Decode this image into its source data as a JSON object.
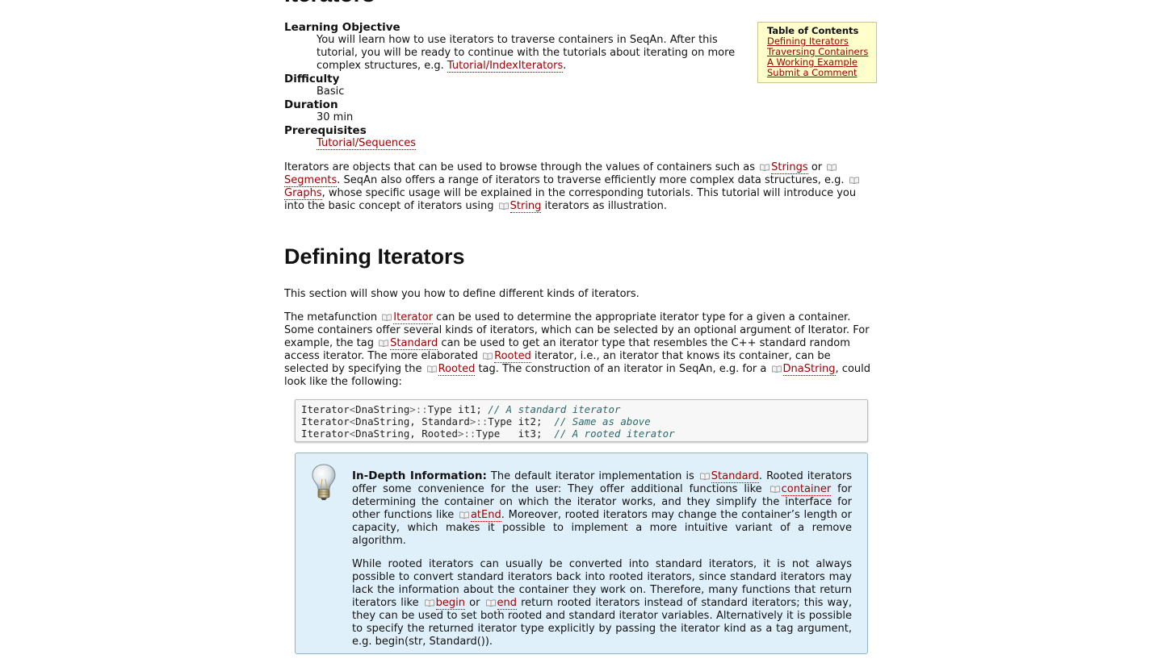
{
  "page_title": "Iterators",
  "meta": {
    "learning_objective_label": "Learning Objective",
    "learning_objective_text_before": "You will learn how to use iterators to traverse containers in SeqAn. After this tutorial, you will be ready to continue with the tutorials about iterating on more complex structures, e.g. ",
    "learning_objective_link": "Tutorial/IndexIterators",
    "learning_objective_text_after": ".",
    "difficulty_label": "Difficulty",
    "difficulty_value": "Basic",
    "duration_label": "Duration",
    "duration_value": "30 min",
    "prerequisites_label": "Prerequisites",
    "prerequisites_link": "Tutorial/Sequences"
  },
  "toc": {
    "title": "Table of Contents",
    "items": [
      "Defining Iterators",
      "Traversing Containers",
      "A Working Example",
      "Submit a Comment"
    ]
  },
  "intro": {
    "t1": "Iterators are objects that can be used to browse through the values of containers such as ",
    "l1": "Strings",
    "t2": " or ",
    "l2": "Segments",
    "t3": ". SeqAn also offers a range of iterators to traverse efficiently more complex data structures, e.g. ",
    "l3": "Graphs",
    "t4": ", whose specific usage will be explained in the corresponding tutorials. This tutorial will introduce you into the basic concept of iterators using ",
    "l4": "String",
    "t5": " iterators as illustration."
  },
  "section_heading": "Defining Iterators",
  "section_intro": "This section will show you how to define different kinds of iterators.",
  "metafunction": {
    "t1": "The metafunction ",
    "l1": "Iterator",
    "t2": " can be used to determine the appropriate iterator type for a given a container. Some containers offer several kinds of iterators, which can be selected by an optional argument of Iterator. For example, the tag ",
    "l2": "Standard",
    "t3": " can be used to get an iterator type that resembles the C++ standard random access iterator. The more elaborated ",
    "l3": "Rooted",
    "t4": " iterator, i.e., an iterator that knows its container, can be selected by specifying the ",
    "l4": "Rooted",
    "t5": " tag. The construction of an iterator in SeqAn, e.g. for a ",
    "l5": "DnaString",
    "t6": ", could look like the following:"
  },
  "code": {
    "line1": {
      "a": "Iterator",
      "b": "<",
      "c": "DnaString",
      "d": ">::",
      "e": "Type it1; ",
      "f": "// A standard iterator"
    },
    "line2": {
      "a": "Iterator",
      "b": "<",
      "c": "DnaString, Standard",
      "d": ">::",
      "e": "Type it2;  ",
      "f": "// Same as above"
    },
    "line3": {
      "a": "Iterator",
      "b": "<",
      "c": "DnaString, Rooted",
      "d": ">::",
      "e": "Type   it3;  ",
      "f": "// A rooted iterator"
    }
  },
  "info": {
    "heading": "In-Depth Information:",
    "p1": {
      "t1": " The default iterator implementation is ",
      "l1": "Standard",
      "t2": ". Rooted iterators offer some convenience for the user: They offer additional functions like ",
      "l2": "container",
      "t3": " for determining the container on which the iterator works, and they simplify the interface for other functions like ",
      "l3": "atEnd",
      "t4": ". Moreover, rooted iterators may change the container’s length or capacity, which makes it possible to implement a more intuitive variant of a remove algorithm."
    },
    "p2": {
      "t1": "While rooted iterators can usually be converted into standard iterators, it is not always possible to convert standard iterators back into rooted iterators, since standard iterators may lack the information about the container they work on. Therefore, many functions that return iterators like ",
      "l1": "begin",
      "t2": " or ",
      "l2": "end",
      "t3": " return rooted iterators instead of standard iterators; this way, they can be used to set both rooted and standard iterator variables. Alternatively it is possible to specify the returned iterator type explicitly by passing the iterator kind as a tag argument, e.g. begin(str, Standard())."
    }
  },
  "icons": {
    "book": "book-icon",
    "bulb": "lightbulb-icon"
  },
  "colors": {
    "link": "#a00000",
    "toc_bg": "#ffffcc",
    "info_bg": "#e0f0fb",
    "code_comment": "#2b6a6a"
  }
}
